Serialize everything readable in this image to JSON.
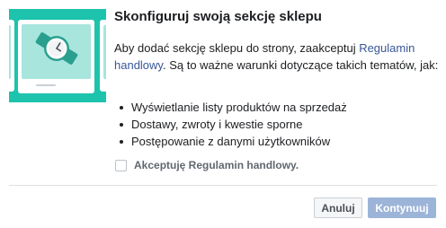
{
  "dialog": {
    "title": "Skonfiguruj swoją sekcję sklepu",
    "description_before_link": "Aby dodać sekcję sklepu do strony, zaakceptuj ",
    "terms_link": "Regulamin handlowy",
    "description_after_link": ". Są to ważne warunki dotyczące takich tematów, jak:",
    "bullets": [
      "Wyświetlanie listy produktów na sprzedaż",
      "Dostawy, zwroty i kwestie sporne",
      "Postępowanie z danymi użytkowników"
    ],
    "accept_checkbox": {
      "label": "Akceptuję Regulamin handlowy.",
      "checked": false
    },
    "buttons": {
      "cancel": "Anuluj",
      "continue": "Kontynuuj"
    }
  },
  "illustration": {
    "icon": "watch-icon"
  },
  "colors": {
    "illustration_bg": "#1dc3ad",
    "link": "#385898",
    "continue_disabled": "#9cb4d8"
  }
}
